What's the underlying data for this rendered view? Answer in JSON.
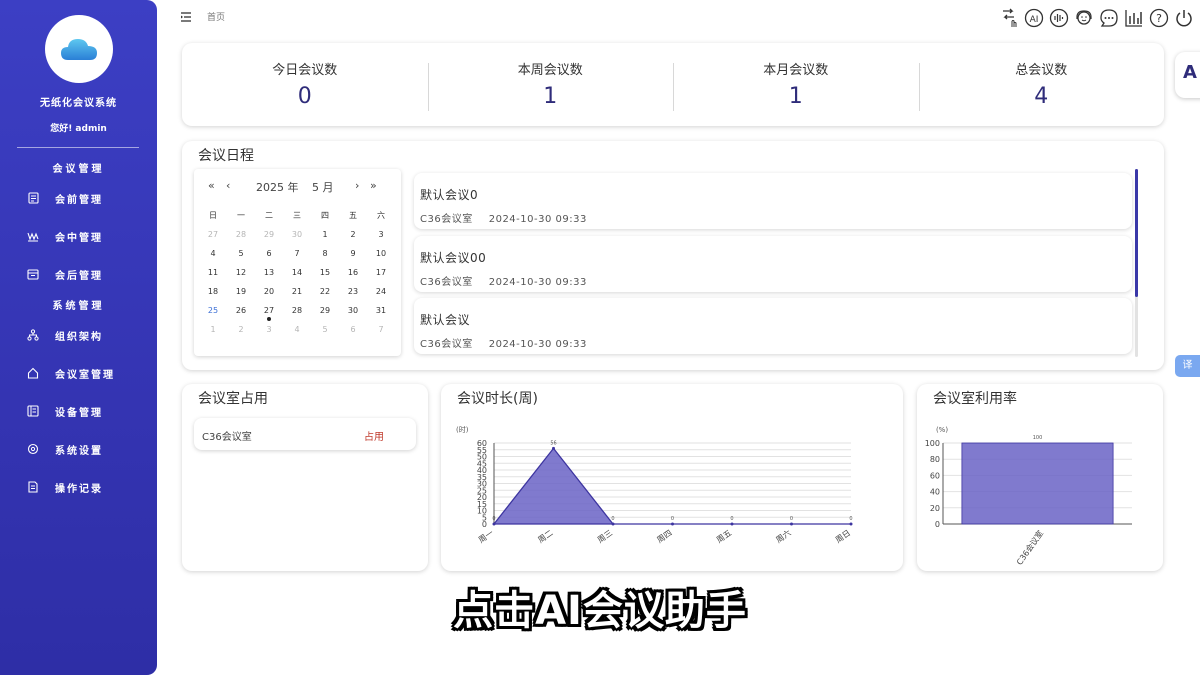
{
  "sidebar": {
    "title": "无纸化会议系统",
    "greeting": "您好! admin",
    "section_meeting": "会议管理",
    "section_system": "系统管理",
    "items": [
      {
        "label": "会前管理",
        "icon": "document-icon"
      },
      {
        "label": "会中管理",
        "icon": "meeting-icon"
      },
      {
        "label": "会后管理",
        "icon": "archive-icon"
      },
      {
        "label": "组织架构",
        "icon": "org-chart-icon"
      },
      {
        "label": "会议室管理",
        "icon": "home-icon"
      },
      {
        "label": "设备管理",
        "icon": "device-icon"
      },
      {
        "label": "系统设置",
        "icon": "settings-icon"
      },
      {
        "label": "操作记录",
        "icon": "log-icon"
      }
    ]
  },
  "header": {
    "breadcrumb": "首页",
    "right_tab": "A",
    "translate_tab": "译"
  },
  "stats": [
    {
      "label": "今日会议数",
      "value": "0"
    },
    {
      "label": "本周会议数",
      "value": "1"
    },
    {
      "label": "本月会议数",
      "value": "1"
    },
    {
      "label": "总会议数",
      "value": "4"
    }
  ],
  "schedule": {
    "title": "会议日程",
    "calendar": {
      "year_label": "2025 年",
      "month_label": "5 月",
      "prev_year": "«",
      "prev_month": "‹",
      "next_month": "›",
      "next_year": "»",
      "weekdays": [
        "日",
        "一",
        "二",
        "三",
        "四",
        "五",
        "六"
      ],
      "weeks": [
        [
          "27",
          "28",
          "29",
          "30",
          "1",
          "2",
          "3"
        ],
        [
          "4",
          "5",
          "6",
          "7",
          "8",
          "9",
          "10"
        ],
        [
          "11",
          "12",
          "13",
          "14",
          "15",
          "16",
          "17"
        ],
        [
          "18",
          "19",
          "20",
          "21",
          "22",
          "23",
          "24"
        ],
        [
          "25",
          "26",
          "27",
          "28",
          "29",
          "30",
          "31"
        ],
        [
          "1",
          "2",
          "3",
          "4",
          "5",
          "6",
          "7"
        ]
      ]
    },
    "meetings": [
      {
        "name": "默认会议0",
        "room": "C36会议室",
        "time": "2024-10-30 09:33"
      },
      {
        "name": "默认会议00",
        "room": "C36会议室",
        "time": "2024-10-30 09:33"
      },
      {
        "name": "默认会议",
        "room": "C36会议室",
        "time": "2024-10-30 09:33"
      }
    ]
  },
  "room_occupancy": {
    "title": "会议室占用",
    "rooms": [
      {
        "name": "C36会议室",
        "status": "占用"
      }
    ]
  },
  "duration_chart": {
    "title": "会议时长(周)",
    "unit": "(时)"
  },
  "usage_chart": {
    "title": "会议室利用率",
    "unit": "(%)"
  },
  "chart_data": [
    {
      "type": "area",
      "title": "会议时长(周)",
      "ylabel": "(时)",
      "categories": [
        "周一",
        "周二",
        "周三",
        "周四",
        "周五",
        "周六",
        "周日"
      ],
      "values": [
        0,
        56,
        0,
        0,
        0,
        0,
        0
      ],
      "ylim": [
        0,
        60
      ],
      "yticks": [
        0,
        5,
        10,
        15,
        20,
        25,
        30,
        35,
        40,
        45,
        50,
        55,
        60
      ],
      "color": "#6a63c6"
    },
    {
      "type": "bar",
      "title": "会议室利用率",
      "ylabel": "(%)",
      "categories": [
        "C36会议室"
      ],
      "values": [
        100
      ],
      "ylim": [
        0,
        100
      ],
      "yticks": [
        0,
        20,
        40,
        60,
        80,
        100
      ],
      "color": "#6a63c6"
    }
  ],
  "toolbar_icons": [
    "transfer-icon",
    "ai-icon",
    "voice-icon",
    "support-icon",
    "chat-icon",
    "chart-icon",
    "help-icon",
    "power-icon"
  ],
  "subtitle": "点击AI会议助手"
}
